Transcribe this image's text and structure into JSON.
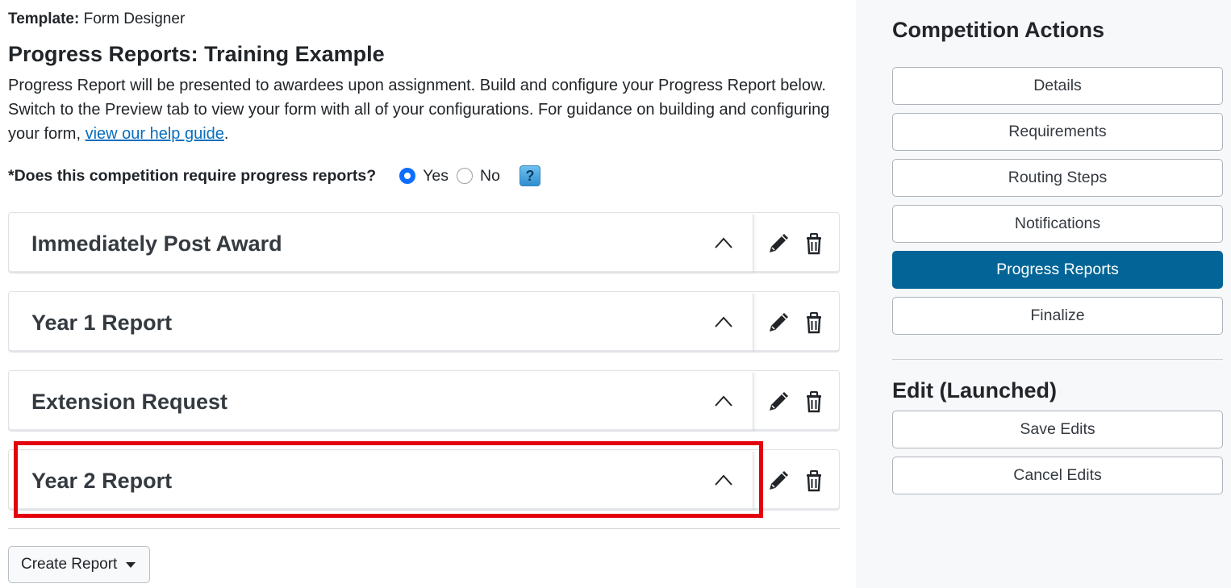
{
  "header": {
    "template_label": "Template:",
    "template_value": "Form Designer",
    "page_title": "Progress Reports: Training Example",
    "intro_text": "Progress Report will be presented to awardees upon assignment. Build and configure your Progress Report below. Switch to the Preview tab to view your form with all of your configurations. For guidance on building and configuring your form, ",
    "help_link": "view our help guide",
    "intro_end": "."
  },
  "requirement": {
    "question": "*Does this competition require progress reports?",
    "options": [
      {
        "label": "Yes",
        "selected": true
      },
      {
        "label": "No",
        "selected": false
      }
    ],
    "help_icon": "?"
  },
  "reports": [
    {
      "title": "Immediately Post Award",
      "expanded": true
    },
    {
      "title": "Year 1 Report",
      "expanded": true
    },
    {
      "title": "Extension Request",
      "expanded": true
    },
    {
      "title": "Year 2 Report",
      "expanded": true,
      "highlighted": true
    }
  ],
  "icons": {
    "collapse": "chevron-up-icon",
    "edit": "pencil-icon",
    "delete": "trash-icon"
  },
  "create_report": {
    "label": "Create Report"
  },
  "sidebar": {
    "competition_heading": "Competition Actions",
    "competition_actions": [
      {
        "label": "Details",
        "active": false
      },
      {
        "label": "Requirements",
        "active": false
      },
      {
        "label": "Routing Steps",
        "active": false
      },
      {
        "label": "Notifications",
        "active": false
      },
      {
        "label": "Progress Reports",
        "active": true
      },
      {
        "label": "Finalize",
        "active": false
      }
    ],
    "edit_heading": "Edit (Launched)",
    "edit_actions": [
      {
        "label": "Save Edits"
      },
      {
        "label": "Cancel Edits"
      }
    ]
  },
  "colors": {
    "active_button": "#036597",
    "radio_selected": "#0d6efd",
    "highlight_border": "#e3000f",
    "link": "#0a6ebd"
  }
}
